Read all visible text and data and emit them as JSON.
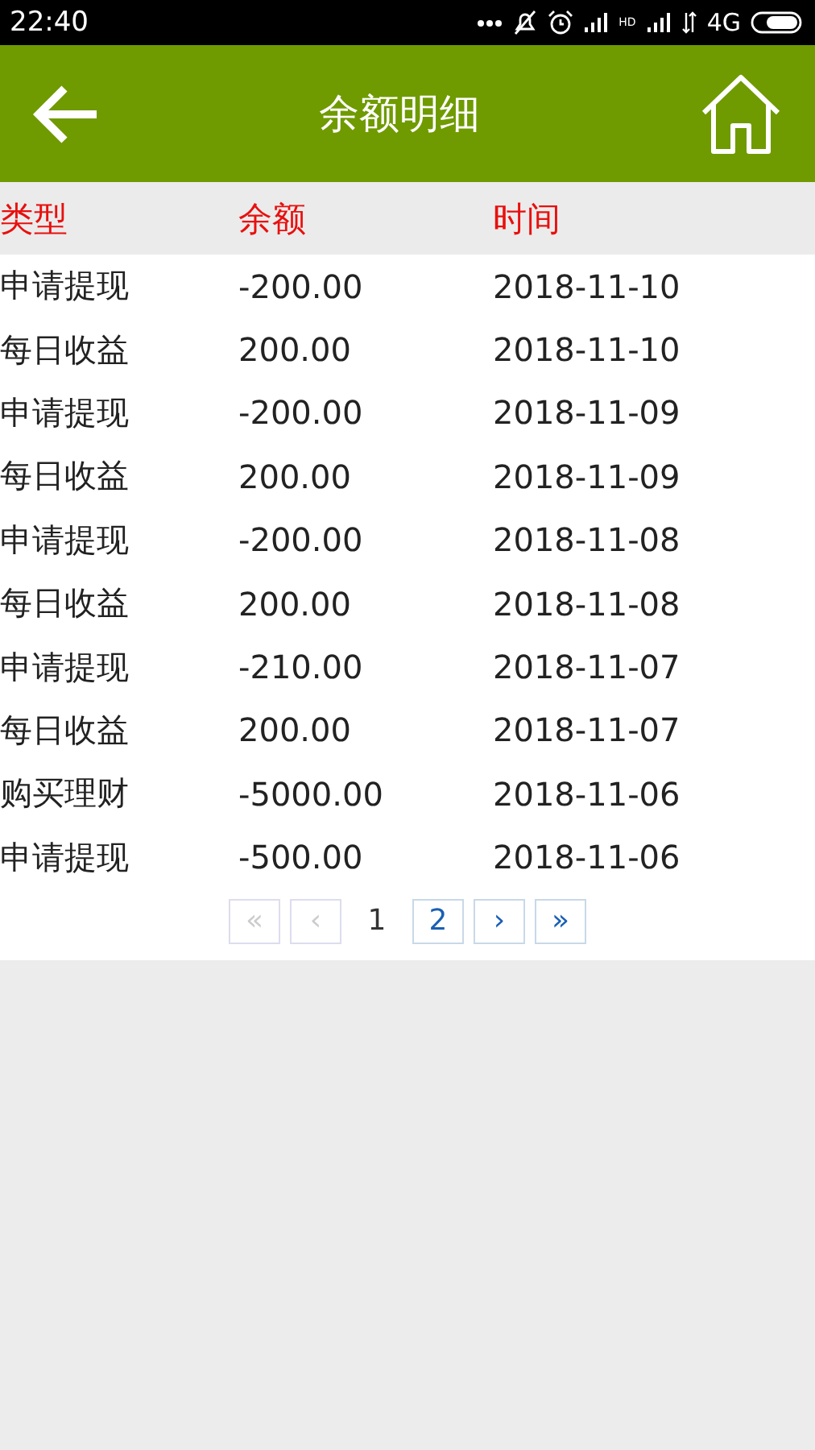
{
  "status_bar": {
    "time": "22:40",
    "hd": "HD",
    "network": "4G"
  },
  "header": {
    "title": "余额明细"
  },
  "table": {
    "columns": [
      "类型",
      "余额",
      "时间"
    ],
    "rows": [
      [
        "申请提现",
        "-200.00",
        "2018-11-10"
      ],
      [
        "每日收益",
        "200.00",
        "2018-11-10"
      ],
      [
        "申请提现",
        "-200.00",
        "2018-11-09"
      ],
      [
        "每日收益",
        "200.00",
        "2018-11-09"
      ],
      [
        "申请提现",
        "-200.00",
        "2018-11-08"
      ],
      [
        "每日收益",
        "200.00",
        "2018-11-08"
      ],
      [
        "申请提现",
        "-210.00",
        "2018-11-07"
      ],
      [
        "每日收益",
        "200.00",
        "2018-11-07"
      ],
      [
        "购买理财",
        "-5000.00",
        "2018-11-06"
      ],
      [
        "申请提现",
        "-500.00",
        "2018-11-06"
      ]
    ]
  },
  "pagination": [
    {
      "label": "«",
      "disabled": true,
      "selected": false
    },
    {
      "label": "‹",
      "disabled": true,
      "selected": false
    },
    {
      "label": "1",
      "disabled": false,
      "selected": true
    },
    {
      "label": "2",
      "disabled": false,
      "selected": false
    },
    {
      "label": "›",
      "disabled": false,
      "selected": false
    },
    {
      "label": "»",
      "disabled": false,
      "selected": false
    }
  ]
}
